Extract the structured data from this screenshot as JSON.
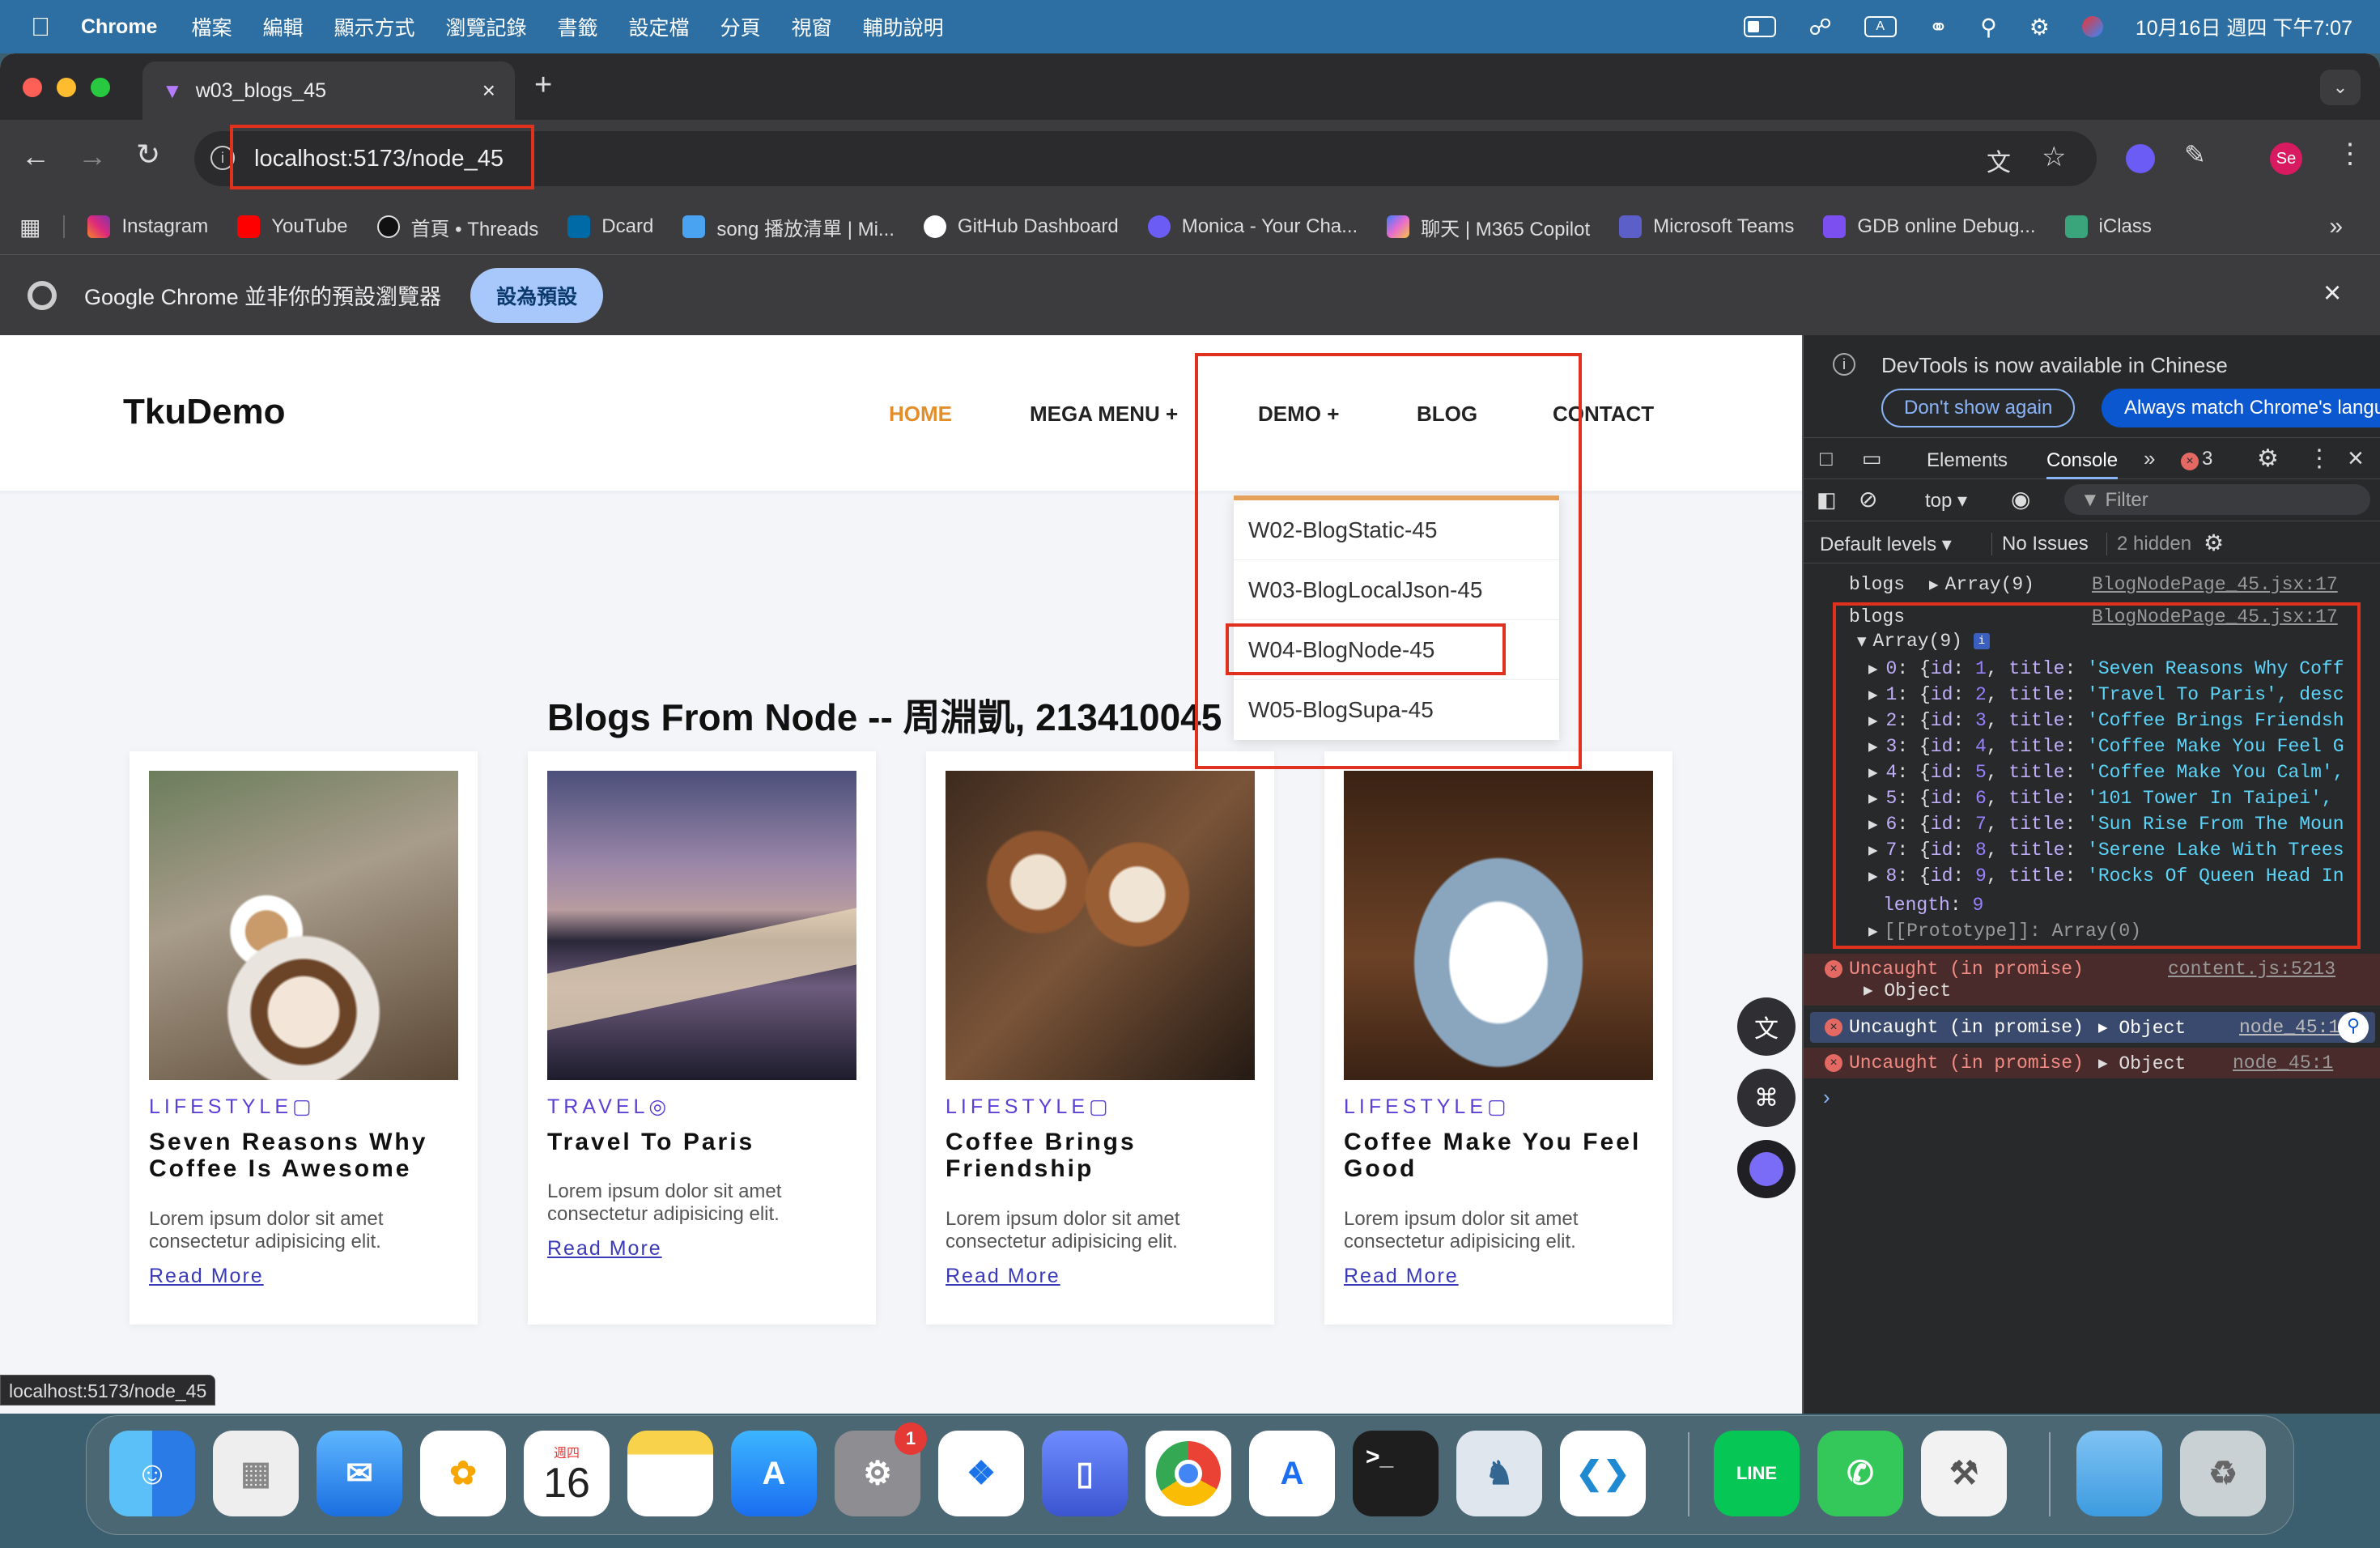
{
  "menubar": {
    "app": "Chrome",
    "items": [
      "檔案",
      "編輯",
      "顯示方式",
      "瀏覽記錄",
      "書籤",
      "設定檔",
      "分頁",
      "視窗",
      "輔助說明"
    ],
    "clock": "10月16日 週四 下午7:07",
    "input_indicator": "A"
  },
  "browser": {
    "tab_title": "w03_blogs_45",
    "url": "localhost:5173/node_45",
    "profile_initials": "Se",
    "bookmarks": [
      "Instagram",
      "YouTube",
      "首頁 • Threads",
      "Dcard",
      "song 播放清單 | Mi...",
      "GitHub Dashboard",
      "Monica - Your Cha...",
      "聊天 | M365 Copilot",
      "Microsoft Teams",
      "GDB online Debug...",
      "iClass"
    ],
    "infobar_text": "Google Chrome 並非你的預設瀏覽器",
    "infobar_button": "設為預設",
    "status_url": "localhost:5173/node_45"
  },
  "site": {
    "logo": "TkuDemo",
    "nav": [
      "HOME",
      "MEGA MENU +",
      "DEMO +",
      "BLOG",
      "CONTACT"
    ],
    "demo_menu": [
      "W02-BlogStatic-45",
      "W03-BlogLocalJson-45",
      "W04-BlogNode-45",
      "W05-BlogSupa-45"
    ],
    "page_title": "Blogs From Node -- 周淵凱, 213410045",
    "cards": [
      {
        "category": "LIFESTYLE",
        "title": "Seven Reasons Why Coffee Is Awesome",
        "desc": "Lorem ipsum dolor sit amet consectetur adipisicing elit.",
        "more": "Read More"
      },
      {
        "category": "TRAVEL",
        "title": "Travel To Paris",
        "desc": "Lorem ipsum dolor sit amet consectetur adipisicing elit.",
        "more": "Read More"
      },
      {
        "category": "LIFESTYLE",
        "title": "Coffee Brings Friendship",
        "desc": "Lorem ipsum dolor sit amet consectetur adipisicing elit.",
        "more": "Read More"
      },
      {
        "category": "LIFESTYLE",
        "title": "Coffee Make You Feel Good",
        "desc": "Lorem ipsum dolor sit amet consectetur adipisicing elit.",
        "more": "Read More"
      }
    ]
  },
  "devtools": {
    "notice": "DevTools is now available in Chinese",
    "btn_dont_show": "Don't show again",
    "btn_match": "Always match Chrome's language",
    "tabs": [
      "Elements",
      "Console"
    ],
    "error_count": "3",
    "context": "top",
    "filter_placeholder": "Filter",
    "levels": "Default levels",
    "issues": "No Issues",
    "hidden": "2 hidden",
    "log1": {
      "label": "blogs",
      "value": "Array(9)",
      "source": "BlogNodePage_45.jsx:17"
    },
    "log2": {
      "label": "blogs",
      "value": "Array(9)",
      "source": "BlogNodePage_45.jsx:17"
    },
    "entries": [
      {
        "idx": "0",
        "id": "1",
        "title": "'Seven Reasons Why Coff"
      },
      {
        "idx": "1",
        "id": "2",
        "title": "'Travel To Paris', desc"
      },
      {
        "idx": "2",
        "id": "3",
        "title": "'Coffee Brings Friendsh"
      },
      {
        "idx": "3",
        "id": "4",
        "title": "'Coffee Make You Feel G"
      },
      {
        "idx": "4",
        "id": "5",
        "title": "'Coffee Make You Calm',"
      },
      {
        "idx": "5",
        "id": "6",
        "title": "'101 Tower In Taipei',"
      },
      {
        "idx": "6",
        "id": "7",
        "title": "'Sun Rise From The Moun"
      },
      {
        "idx": "7",
        "id": "8",
        "title": "'Serene Lake With Trees"
      },
      {
        "idx": "8",
        "id": "9",
        "title": "'Rocks Of Queen Head In"
      }
    ],
    "length_label": "length",
    "length_value": "9",
    "prototype": "[[Prototype]]: Array(0)",
    "errors": [
      {
        "text": "Uncaught (in promise)",
        "detail": "Object",
        "source": "content.js:5213"
      },
      {
        "text": "Uncaught (in promise)",
        "detail": "Object",
        "source": "node_45:1"
      },
      {
        "text": "Uncaught (in promise)",
        "detail": "Object",
        "source": "node_45:1"
      }
    ]
  },
  "dock": {
    "calendar_day": "16",
    "calendar_weekday": "週四",
    "settings_badge": "1",
    "line_label": "LINE"
  }
}
